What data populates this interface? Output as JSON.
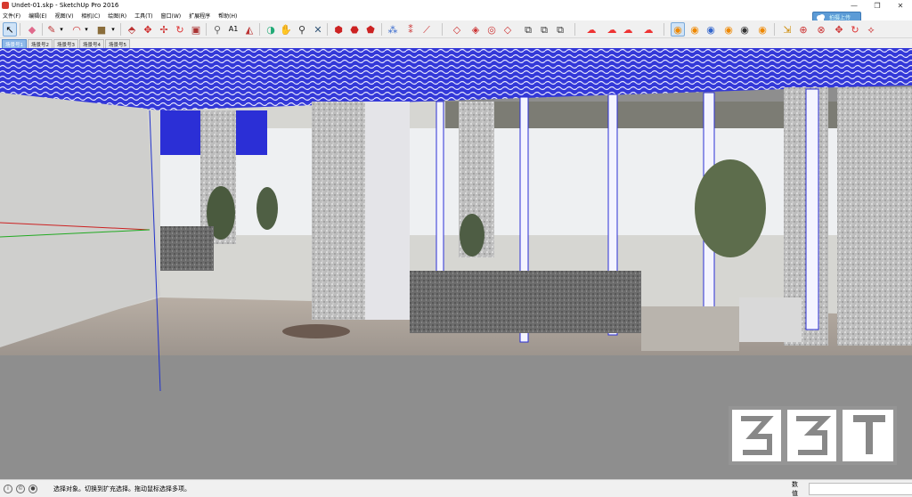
{
  "window": {
    "title": "Undet-01.skp - SketchUp Pro 2016",
    "controls": [
      "—",
      "❐",
      "✕"
    ]
  },
  "menu": [
    "文件(F)",
    "编辑(E)",
    "视图(V)",
    "相机(C)",
    "绘图(R)",
    "工具(T)",
    "窗口(W)",
    "扩展程序",
    "帮助(H)"
  ],
  "share_button": {
    "label": "拍摄上传",
    "icon": "cloud-upload-icon",
    "color": "#5c9bd6"
  },
  "toolbar": {
    "icons": [
      "select-icon",
      "eraser-icon",
      "pencil-icon",
      "dropdown-arrow-icon",
      "arc-icon",
      "dropdown-arrow-icon",
      "rectangle-icon",
      "dropdown-arrow-icon",
      "push-pull-icon",
      "move-icon",
      "rotate-icon",
      "scale-icon",
      "follow-me-icon",
      "offset-icon",
      "tape-measure-icon",
      "text-icon",
      "protractor-icon",
      "axes-icon",
      "dimensions-icon",
      "orbit-icon",
      "pan-icon",
      "zoom-icon",
      "zoom-extents-icon",
      "warehouse-icon",
      "components-icon",
      "extension-warehouse-icon",
      "scatter-icon",
      "section-icon",
      "walk-icon",
      "style-icon",
      "shadow-icon",
      "fog-icon",
      "cloud-icon",
      "point-cloud-icon",
      "camera-icon",
      "import-icon",
      "export-icon",
      "settings-icon",
      "refresh-icon",
      "logo-icon"
    ]
  },
  "scene_tabs": [
    "场景号1",
    "场景号2",
    "场景号3",
    "场景号4",
    "场景号5"
  ],
  "active_scene": "场景号1",
  "status": {
    "icons": [
      "info-icon",
      "credit-icon",
      "user-icon"
    ],
    "text": "选择对象。切换到扩充选择。拖动鼠标选择多项。",
    "measure_label": "数值",
    "measure_value": ""
  },
  "colors": {
    "accent": "#5c9bd6",
    "ceiling": "#2b2fd6",
    "floor": "#8c8c8c",
    "active_tab": "#8db8e8"
  }
}
